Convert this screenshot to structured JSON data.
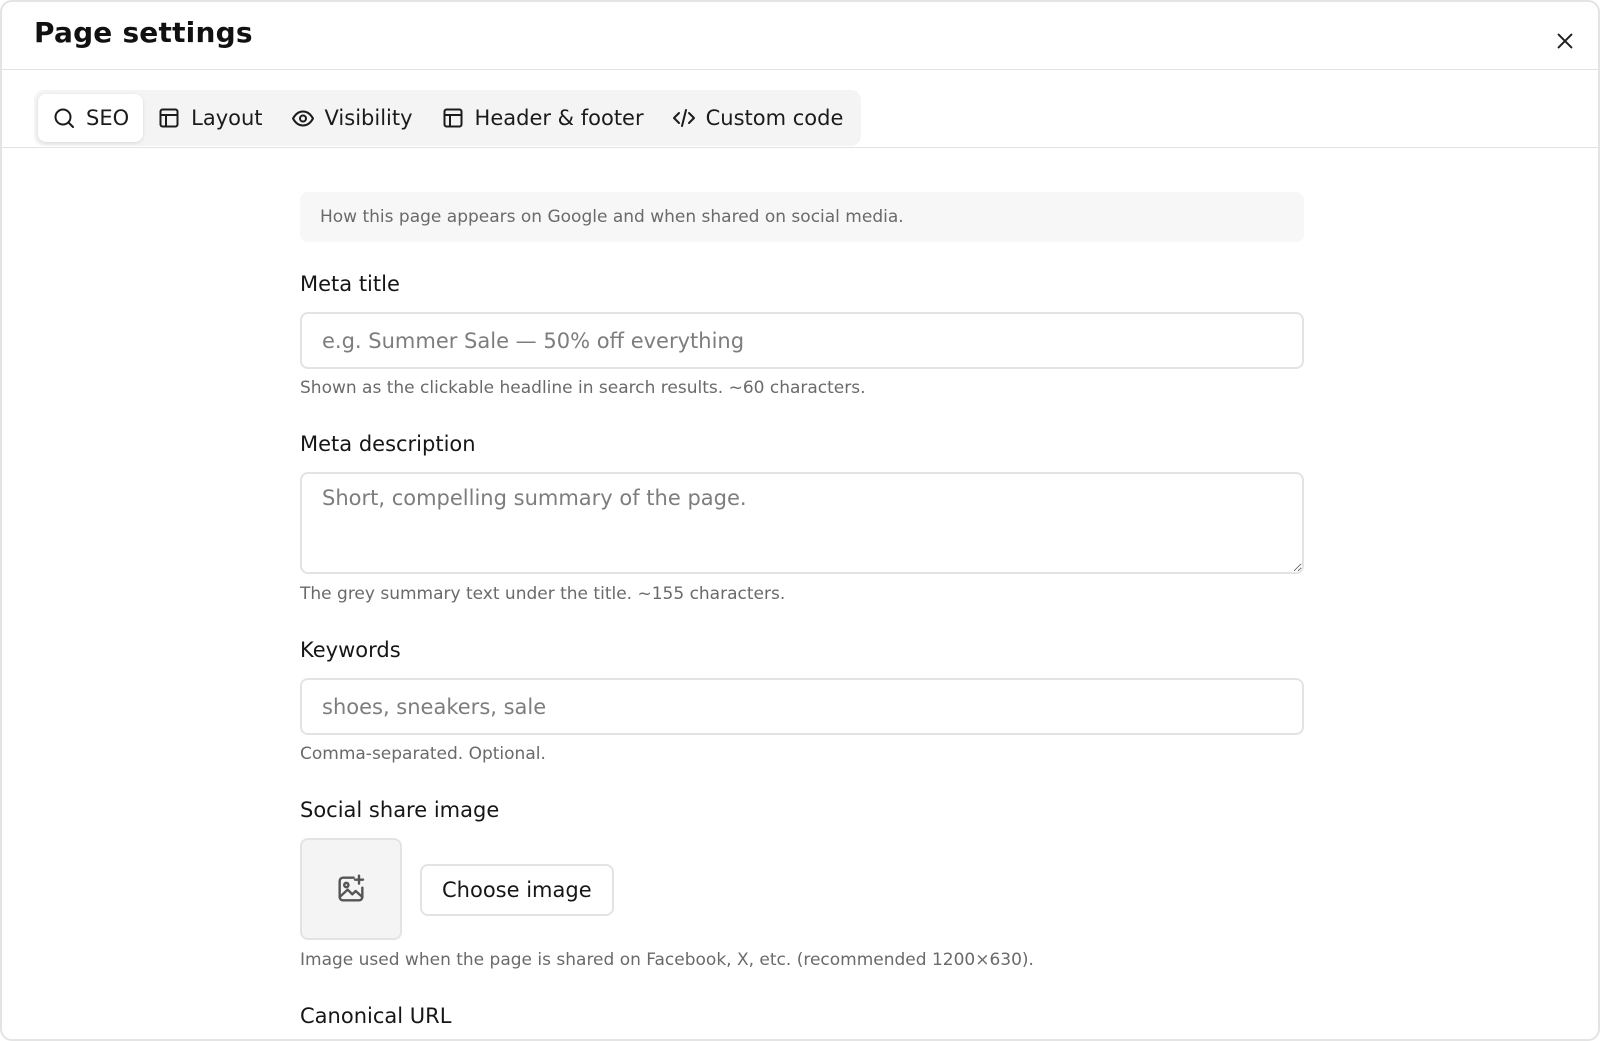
{
  "dialog": {
    "title": "Page settings",
    "close_icon": "close-icon"
  },
  "tabs": [
    {
      "label": "SEO",
      "icon": "search-icon",
      "active": true
    },
    {
      "label": "Layout",
      "icon": "layout-icon",
      "active": false
    },
    {
      "label": "Visibility",
      "icon": "eye-icon",
      "active": false
    },
    {
      "label": "Header & footer",
      "icon": "layout-icon",
      "active": false
    },
    {
      "label": "Custom code",
      "icon": "code-icon",
      "active": false
    }
  ],
  "seo": {
    "intro": "How this page appears on Google and when shared on social media.",
    "meta_title": {
      "label": "Meta title",
      "placeholder": "e.g. Summer Sale — 50% off everything",
      "value": "",
      "hint": "Shown as the clickable headline in search results. ~60 characters."
    },
    "meta_description": {
      "label": "Meta description",
      "placeholder": "Short, compelling summary of the page.",
      "value": "",
      "hint": "The grey summary text under the title. ~155 characters."
    },
    "keywords": {
      "label": "Keywords",
      "placeholder": "shoes, sneakers, sale",
      "value": "",
      "hint": "Comma-separated. Optional."
    },
    "social_image": {
      "label": "Social share image",
      "icon": "image-add-icon",
      "button_label": "Choose image",
      "hint": "Image used when the page is shared on Facebook, X, etc. (recommended 1200×630)."
    },
    "canonical": {
      "label": "Canonical URL"
    }
  },
  "colors": {
    "border": "#e3e3e3",
    "muted_text": "#6a6a6a",
    "tab_bg": "#f4f4f4"
  }
}
